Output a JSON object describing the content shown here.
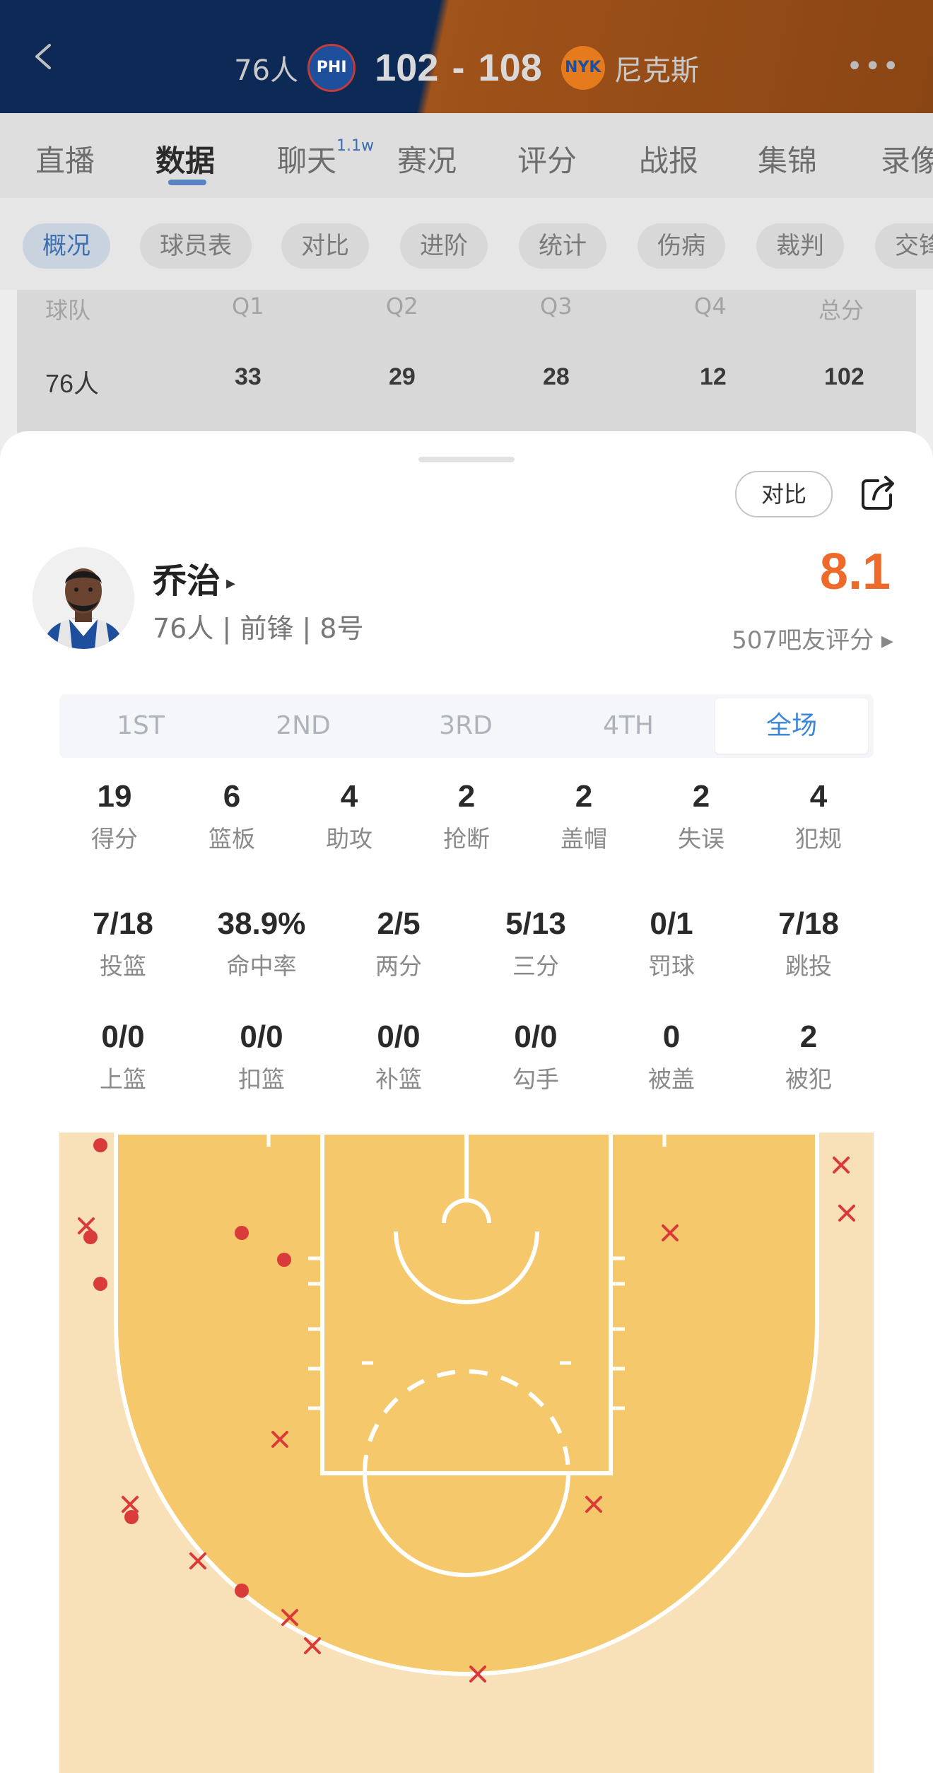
{
  "header": {
    "home_team": "76人",
    "home_logo": "PHI",
    "home_score": "102",
    "separator": "-",
    "away_score": "108",
    "away_logo": "NYK",
    "away_team": "尼克斯",
    "more_label": "•••"
  },
  "main_tabs": [
    {
      "label": "直播",
      "sup": ""
    },
    {
      "label": "数据",
      "sup": ""
    },
    {
      "label": "聊天",
      "sup": "1.1w"
    },
    {
      "label": "赛况",
      "sup": ""
    },
    {
      "label": "评分",
      "sup": ""
    },
    {
      "label": "战报",
      "sup": ""
    },
    {
      "label": "集锦",
      "sup": ""
    },
    {
      "label": "录像",
      "sup": ""
    }
  ],
  "sub_tabs": [
    "概况",
    "球员表",
    "对比",
    "进阶",
    "统计",
    "伤病",
    "裁判",
    "交锋"
  ],
  "quarter_table": {
    "headers": [
      "球队",
      "Q1",
      "Q2",
      "Q3",
      "Q4",
      "总分"
    ],
    "row": [
      "76人",
      "33",
      "29",
      "28",
      "12",
      "102"
    ]
  },
  "sheet": {
    "compare_label": "对比",
    "player": {
      "name": "乔治",
      "name_arrow": "▸",
      "info": "76人 | 前锋 | 8号",
      "rating": "8.1",
      "rating_count": "507吧友评分 ▸"
    },
    "period_tabs": [
      "1ST",
      "2ND",
      "3RD",
      "4TH",
      "全场"
    ],
    "active_period": "全场",
    "stats_row1": [
      {
        "value": "19",
        "label": "得分"
      },
      {
        "value": "6",
        "label": "篮板"
      },
      {
        "value": "4",
        "label": "助攻"
      },
      {
        "value": "2",
        "label": "抢断"
      },
      {
        "value": "2",
        "label": "盖帽"
      },
      {
        "value": "2",
        "label": "失误"
      },
      {
        "value": "4",
        "label": "犯规"
      }
    ],
    "stats_row2": [
      {
        "value": "7/18",
        "label": "投篮"
      },
      {
        "value": "38.9%",
        "label": "命中率"
      },
      {
        "value": "2/5",
        "label": "两分"
      },
      {
        "value": "5/13",
        "label": "三分"
      },
      {
        "value": "0/1",
        "label": "罚球"
      },
      {
        "value": "7/18",
        "label": "跳投"
      }
    ],
    "stats_row3": [
      {
        "value": "0/0",
        "label": "上篮"
      },
      {
        "value": "0/0",
        "label": "扣篮"
      },
      {
        "value": "0/0",
        "label": "补篮"
      },
      {
        "value": "0/0",
        "label": "勾手"
      },
      {
        "value": "0",
        "label": "被盖"
      },
      {
        "value": "2",
        "label": "被犯"
      }
    ]
  },
  "colors": {
    "rating": "#ee6a2a",
    "active_tab": "#3c86d8",
    "court_inner": "#f5c86c",
    "court_outer": "#f8e0b8",
    "shot_mark": "#d93a3a"
  },
  "icons": [
    "back-icon",
    "more-icon",
    "share-icon",
    "avatar"
  ]
}
